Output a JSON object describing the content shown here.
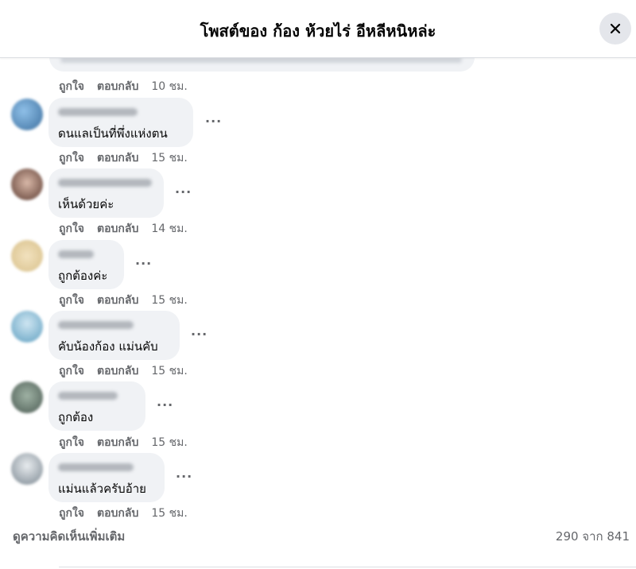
{
  "header": {
    "title": "โพสต์ของ ก้อง ห้วยไร่ อีหลีหนิหล่ะ",
    "close_icon": "close-icon"
  },
  "colors": {
    "bubble": "#f0f2f5",
    "secondary_text": "#65676b",
    "close_bg": "#e4e6eb"
  },
  "top_actions": {
    "like": "ถูกใจ",
    "reply": "ตอบกลับ",
    "time": "10 ชม."
  },
  "comments": [
    {
      "text": "ดนแลเป็นที่พึ่งแห่งตน",
      "like": "ถูกใจ",
      "reply": "ตอบกลับ",
      "time": "15 ชม.",
      "avatar_color": "#5a8fc0"
    },
    {
      "text": "เห็นด้วยค่ะ",
      "like": "ถูกใจ",
      "reply": "ตอบกลับ",
      "time": "14 ชม.",
      "avatar_color": "#7a5a4e"
    },
    {
      "text": "ถูกต้องค่ะ",
      "like": "ถูกใจ",
      "reply": "ตอบกลับ",
      "time": "15 ชม.",
      "avatar_color": "#e8d5a8"
    },
    {
      "text": "คับน้องก้อง แม่นคับ",
      "like": "ถูกใจ",
      "reply": "ตอบกลับ",
      "time": "15 ชม.",
      "avatar_color": "#7fb8d6"
    },
    {
      "text": "ถูกต้อง",
      "like": "ถูกใจ",
      "reply": "ตอบกลับ",
      "time": "15 ชม.",
      "avatar_color": "#6b7a70"
    },
    {
      "text": "แม่นแล้วครับอ้าย",
      "like": "ถูกใจ",
      "reply": "ตอบกลับ",
      "time": "15 ชม.",
      "avatar_color": "#a0a8b0"
    }
  ],
  "more_icon_label": "···",
  "footer": {
    "view_more": "ดูความคิดเห็นเพิ่มเติม",
    "count": "290 จาก 841"
  }
}
